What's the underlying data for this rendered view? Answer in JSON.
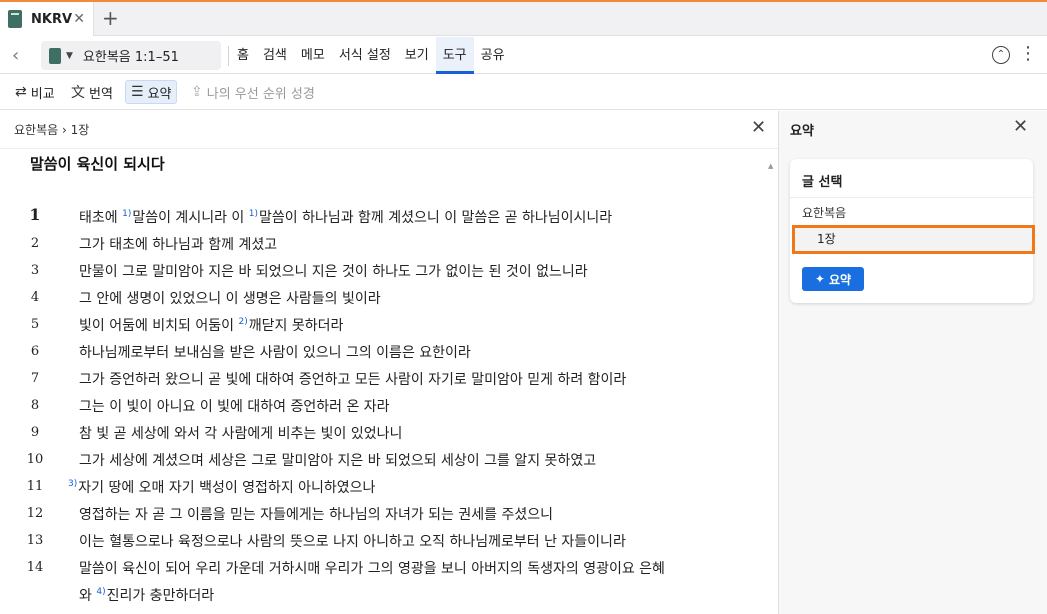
{
  "tabbar": {
    "tab_title": "NKRV",
    "close": "✕",
    "new_tab": "+"
  },
  "toolbar": {
    "back": "‹",
    "reference": "요한복음 1:1–51",
    "menu": [
      "홈",
      "검색",
      "메모",
      "서식 설정",
      "보기",
      "도구",
      "공유"
    ],
    "active_menu": "도구",
    "more": "⋮"
  },
  "subbar": {
    "compare": "비교",
    "translate": "번역",
    "summary": "요약",
    "priority": "나의 우선 순위 성경"
  },
  "main": {
    "breadcrumb": "요한복음 › 1장",
    "heading": "말씀이 육신이 되시다",
    "verses": [
      {
        "num": "1",
        "segments": [
          "태초에 ",
          "1)",
          "말씀이 계시니라 이 ",
          "1)",
          "말씀이 하나님과 함께 계셨으니 이 말씀은 곧 하나님이시니라"
        ]
      },
      {
        "num": "2",
        "text": "그가 태초에 하나님과 함께 계셨고"
      },
      {
        "num": "3",
        "text": "만물이 그로 말미암아 지은 바 되었으니 지은 것이 하나도 그가 없이는 된 것이 없느니라"
      },
      {
        "num": "4",
        "text": "그 안에 생명이 있었으니 이 생명은 사람들의 빛이라"
      },
      {
        "num": "5",
        "segments": [
          "빛이 어둠에 비치되 어둠이 ",
          "2)",
          "깨닫지 못하더라"
        ]
      },
      {
        "num": "6",
        "text": "하나님께로부터 보내심을 받은 사람이 있으니 그의 이름은 요한이라"
      },
      {
        "num": "7",
        "text": "그가 증언하러 왔으니 곧 빛에 대하여 증언하고 모든 사람이 자기로 말미암아 믿게 하려 함이라"
      },
      {
        "num": "8",
        "text": "그는 이 빛이 아니요 이 빛에 대하여 증언하러 온 자라"
      },
      {
        "num": "9",
        "text": "참 빛 곧 세상에 와서 각 사람에게 비추는 빛이 있었나니"
      },
      {
        "num": "10",
        "text": "그가 세상에 계셨으며 세상은 그로 말미암아 지은 바 되었으되 세상이 그를 알지 못하였고"
      },
      {
        "num": "11",
        "segments": [
          "3)",
          "자기 땅에 오매 자기 백성이 영접하지 아니하였으나"
        ]
      },
      {
        "num": "12",
        "text": "영접하는 자 곧 그 이름을 믿는 자들에게는 하나님의 자녀가 되는 권세를 주셨으니"
      },
      {
        "num": "13",
        "text": "이는 혈통으로나 육정으로나 사람의 뜻으로 나지 아니하고 오직 하나님께로부터 난 자들이니라"
      },
      {
        "num": "14",
        "text": "말씀이 육신이 되어 우리 가운데 거하시매 우리가 그의 영광을 보니 아버지의 독생자의 영광이요 은혜"
      },
      {
        "num": "",
        "segments": [
          "와 ",
          "4)",
          "진리가 충만하더라"
        ]
      }
    ]
  },
  "side": {
    "title": "요약",
    "card_title": "글 선택",
    "book": "요한복음",
    "chapter": "1장",
    "summary_button": "요약"
  },
  "colors": {
    "accent_orange": "#f07818",
    "primary_blue": "#1a6fe0",
    "active_tab_blue": "#1a5fd6"
  }
}
